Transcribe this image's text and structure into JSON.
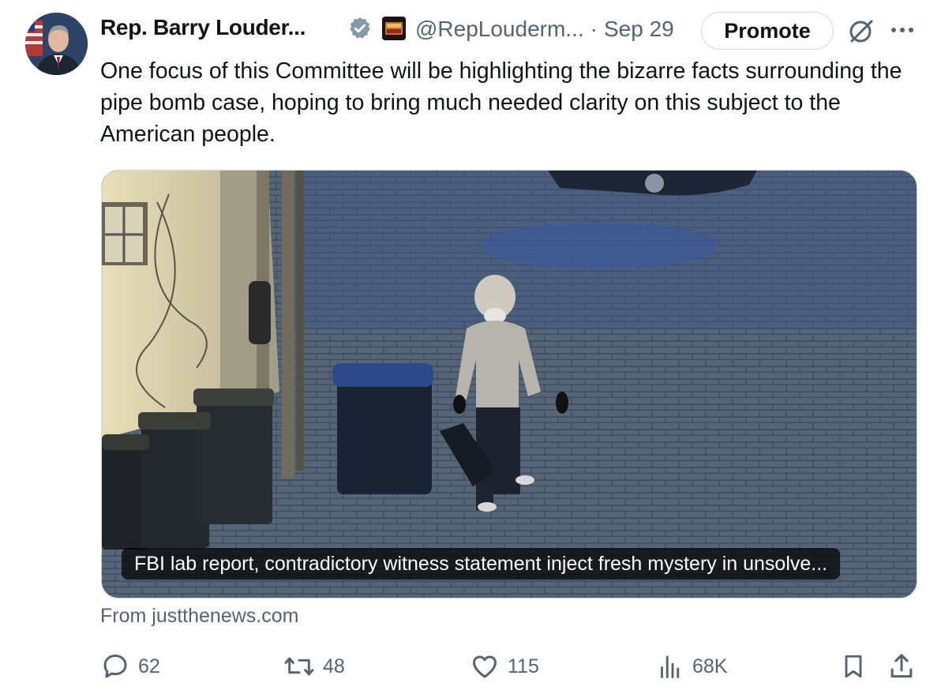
{
  "author": {
    "display_name": "Rep. Barry Louder...",
    "handle": "@RepLouderm...",
    "separator": "·",
    "date": "Sep 29"
  },
  "header": {
    "promote_label": "Promote"
  },
  "post": {
    "text": "One focus of this Committee will be highlighting the bizarre facts surrounding the pipe bomb case, hoping to bring much needed clarity on this subject to the American people."
  },
  "link_card": {
    "caption": "FBI lab report, contradictory witness statement inject fresh mystery in unsolve...",
    "source": "From justthenews.com"
  },
  "metrics": {
    "replies": "62",
    "reposts": "48",
    "likes": "115",
    "views": "68K"
  },
  "icons": {
    "verified": "verified-badge-icon",
    "affiliation": "affiliation-badge-icon",
    "grok": "grok-icon",
    "more": "more-icon",
    "reply": "reply-icon",
    "repost": "repost-icon",
    "like": "like-icon",
    "views": "views-icon",
    "bookmark": "bookmark-icon",
    "share": "share-icon"
  },
  "colors": {
    "text": "#0f1419",
    "secondary": "#536471",
    "verified_badge": "#829aab",
    "border": "#cfd9de"
  }
}
